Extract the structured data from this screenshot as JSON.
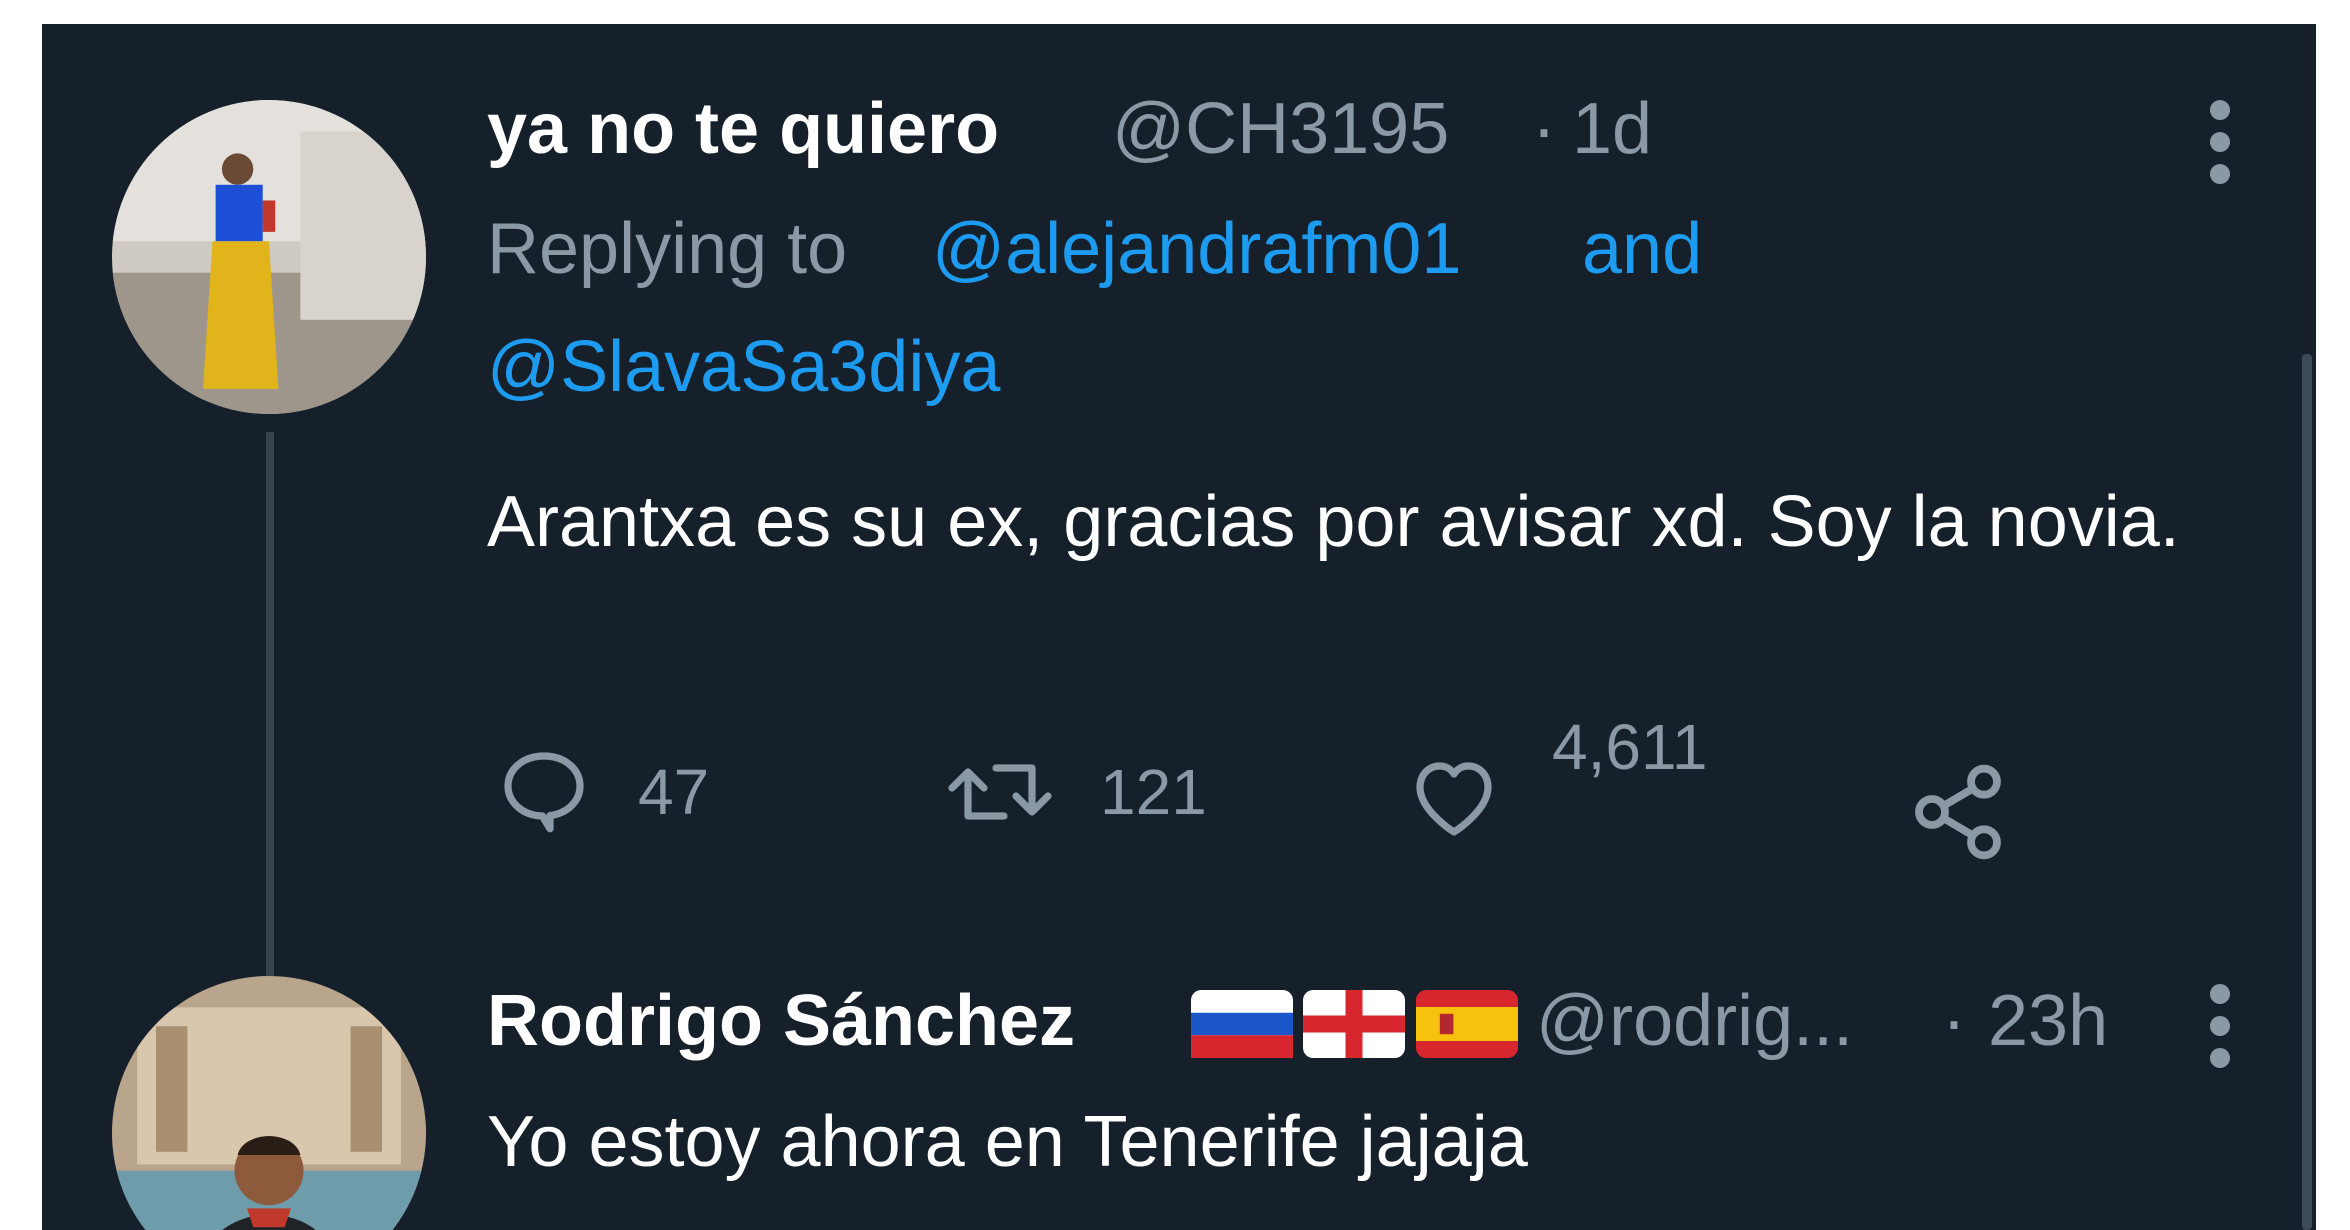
{
  "tweet1": {
    "display_name": "ya no te quiero",
    "handle": "@CH3195",
    "separator": "·",
    "time": "1d",
    "replying_prefix": "Replying to",
    "reply_to_1": "@alejandrafm01",
    "reply_and": "and",
    "reply_to_2": "@SlavaSa3diya",
    "text": "Arantxa es su ex, gracias por avisar xd. Soy la novia.",
    "actions": {
      "replies": "47",
      "retweets": "121",
      "likes": "4,611"
    }
  },
  "tweet2": {
    "display_name": "Rodrigo Sánchez",
    "flags": [
      "russia-flag",
      "england-flag",
      "spain-flag"
    ],
    "handle": "@rodrig...",
    "separator": "·",
    "time": "23h",
    "text": "Yo estoy ahora en Tenerife jajaja"
  },
  "colors": {
    "background": "#15202b",
    "text": "#ffffff",
    "muted": "#8b98a5",
    "link": "#1d9bf0"
  },
  "icons": {
    "more": "more-vertical-icon",
    "reply": "reply-bubble-icon",
    "retweet": "retweet-icon",
    "like": "heart-icon",
    "share": "share-icon"
  }
}
